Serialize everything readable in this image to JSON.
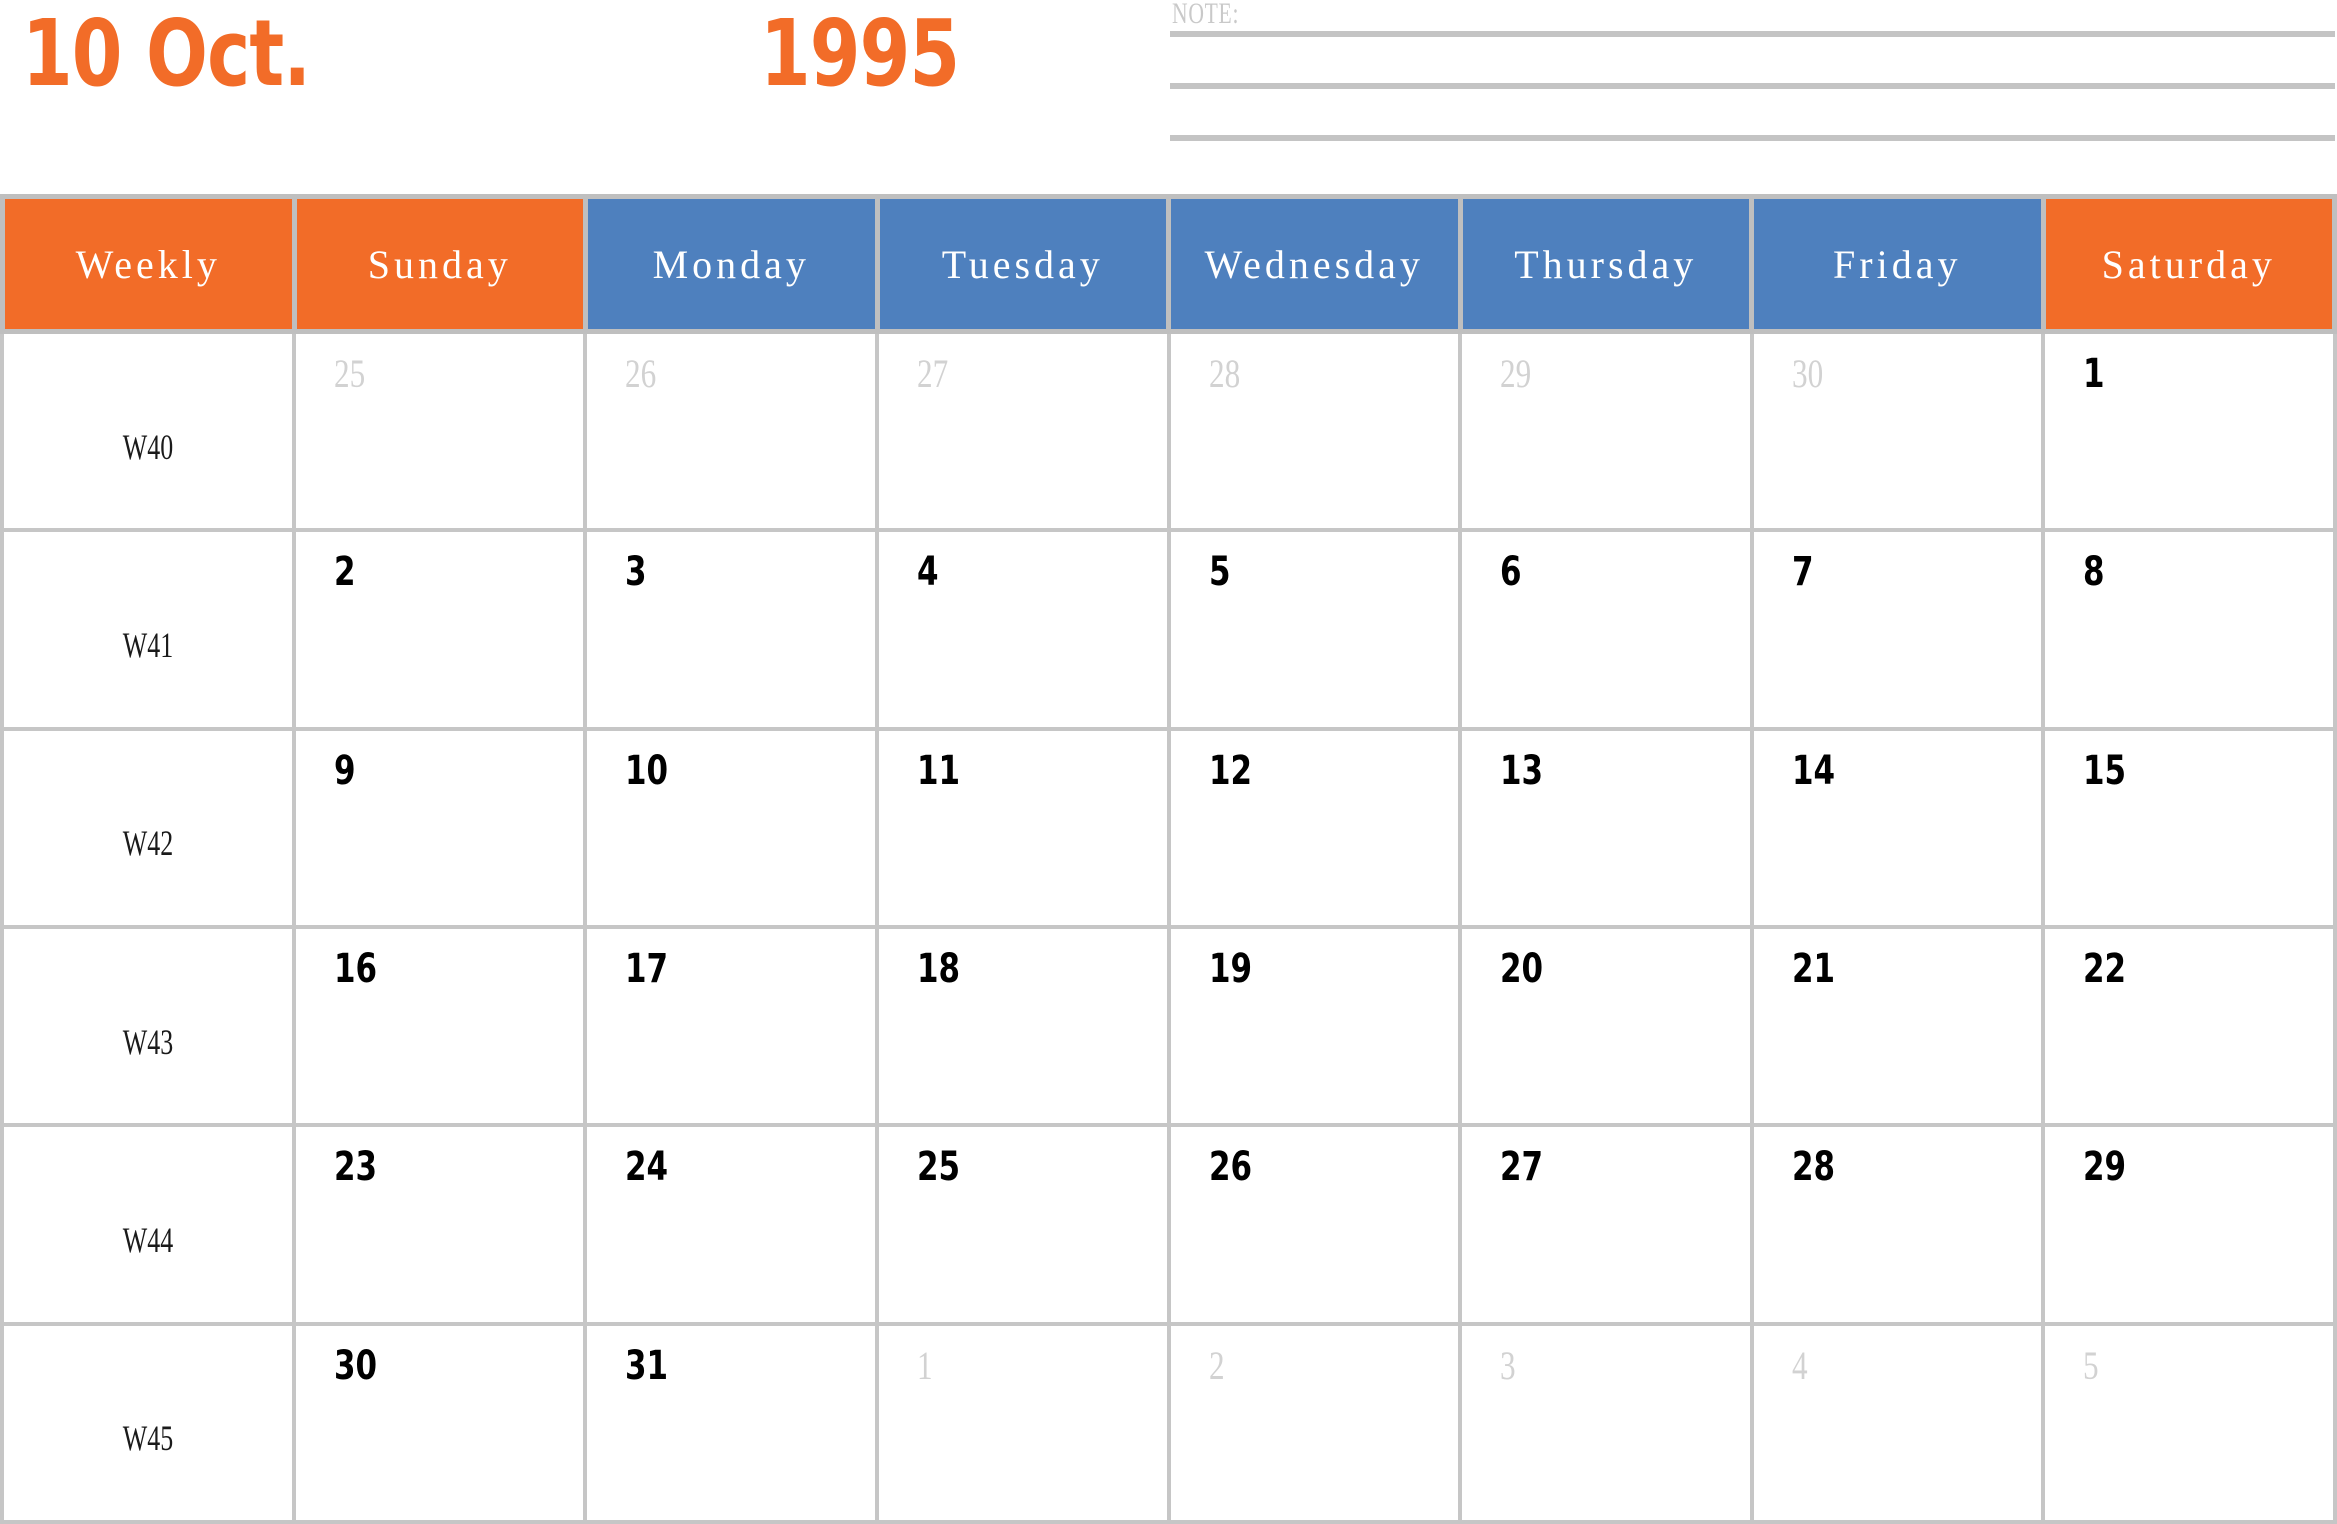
{
  "title": {
    "month": "10 Oct.",
    "year": "1995"
  },
  "note": {
    "label": "NOTE:",
    "lines": [
      "",
      "",
      ""
    ]
  },
  "colors": {
    "orange": "#F26C28",
    "blue": "#4E80BE",
    "border": "#C6C6C6",
    "muted_day": "#D2D2D2",
    "note_rule": "#C4C4C4"
  },
  "calendar": {
    "columns": [
      {
        "label": "Weekly",
        "accent": "orange"
      },
      {
        "label": "Sunday",
        "accent": "orange"
      },
      {
        "label": "Monday",
        "accent": "blue"
      },
      {
        "label": "Tuesday",
        "accent": "blue"
      },
      {
        "label": "Wednesday",
        "accent": "blue"
      },
      {
        "label": "Thursday",
        "accent": "blue"
      },
      {
        "label": "Friday",
        "accent": "blue"
      },
      {
        "label": "Saturday",
        "accent": "orange"
      }
    ],
    "weeks": [
      {
        "week_label": "W40",
        "days": [
          {
            "day": "25",
            "in_month": false
          },
          {
            "day": "26",
            "in_month": false
          },
          {
            "day": "27",
            "in_month": false
          },
          {
            "day": "28",
            "in_month": false
          },
          {
            "day": "29",
            "in_month": false
          },
          {
            "day": "30",
            "in_month": false
          },
          {
            "day": "1",
            "in_month": true
          }
        ]
      },
      {
        "week_label": "W41",
        "days": [
          {
            "day": "2",
            "in_month": true
          },
          {
            "day": "3",
            "in_month": true
          },
          {
            "day": "4",
            "in_month": true
          },
          {
            "day": "5",
            "in_month": true
          },
          {
            "day": "6",
            "in_month": true
          },
          {
            "day": "7",
            "in_month": true
          },
          {
            "day": "8",
            "in_month": true
          }
        ]
      },
      {
        "week_label": "W42",
        "days": [
          {
            "day": "9",
            "in_month": true
          },
          {
            "day": "10",
            "in_month": true
          },
          {
            "day": "11",
            "in_month": true
          },
          {
            "day": "12",
            "in_month": true
          },
          {
            "day": "13",
            "in_month": true
          },
          {
            "day": "14",
            "in_month": true
          },
          {
            "day": "15",
            "in_month": true
          }
        ]
      },
      {
        "week_label": "W43",
        "days": [
          {
            "day": "16",
            "in_month": true
          },
          {
            "day": "17",
            "in_month": true
          },
          {
            "day": "18",
            "in_month": true
          },
          {
            "day": "19",
            "in_month": true
          },
          {
            "day": "20",
            "in_month": true
          },
          {
            "day": "21",
            "in_month": true
          },
          {
            "day": "22",
            "in_month": true
          }
        ]
      },
      {
        "week_label": "W44",
        "days": [
          {
            "day": "23",
            "in_month": true
          },
          {
            "day": "24",
            "in_month": true
          },
          {
            "day": "25",
            "in_month": true
          },
          {
            "day": "26",
            "in_month": true
          },
          {
            "day": "27",
            "in_month": true
          },
          {
            "day": "28",
            "in_month": true
          },
          {
            "day": "29",
            "in_month": true
          }
        ]
      },
      {
        "week_label": "W45",
        "days": [
          {
            "day": "30",
            "in_month": true
          },
          {
            "day": "31",
            "in_month": true
          },
          {
            "day": "1",
            "in_month": false
          },
          {
            "day": "2",
            "in_month": false
          },
          {
            "day": "3",
            "in_month": false
          },
          {
            "day": "4",
            "in_month": false
          },
          {
            "day": "5",
            "in_month": false
          }
        ]
      }
    ]
  }
}
